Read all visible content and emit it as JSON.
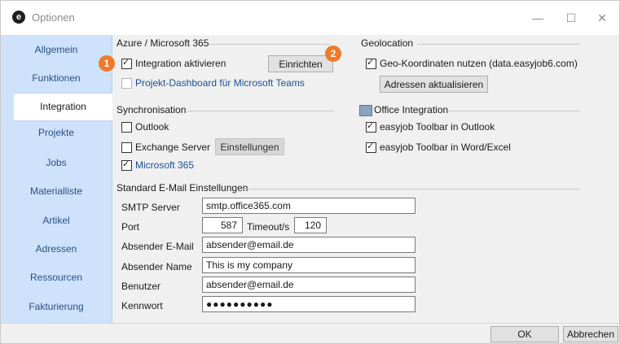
{
  "window": {
    "title": "Optionen",
    "icon": "e",
    "controls": {
      "minimize": "—",
      "maximize": "☐",
      "close": "✕"
    }
  },
  "sidebar": {
    "items": [
      {
        "label": "Allgemein",
        "active": false
      },
      {
        "label": "Funktionen",
        "active": false
      },
      {
        "label": "Integration",
        "active": true
      },
      {
        "label": "Projekte",
        "active": false
      },
      {
        "label": "Jobs",
        "active": false
      },
      {
        "label": "Materialliste",
        "active": false
      },
      {
        "label": "Artikel",
        "active": false
      },
      {
        "label": "Adressen",
        "active": false
      },
      {
        "label": "Ressourcen",
        "active": false
      },
      {
        "label": "Fakturierung",
        "active": false
      }
    ]
  },
  "azure": {
    "title": "Azure / Microsoft 365",
    "integration_label": "Integration aktivieren",
    "integration_checked": true,
    "setup_button": "Einrichten",
    "teams_label": "Projekt-Dashboard für Microsoft Teams",
    "teams_checked": false
  },
  "geo": {
    "title": "Geolocation",
    "coords_label": "Geo-Koordinaten  nutzen (data.easyjob6.com)",
    "coords_checked": true,
    "update_button": "Adressen aktualisieren"
  },
  "sync": {
    "title": "Synchronisation",
    "outlook_label": "Outlook",
    "outlook_checked": false,
    "exchange_label": "Exchange Server",
    "exchange_checked": false,
    "settings_button": "Einstellungen",
    "m365_label": "Microsoft 365",
    "m365_checked": true
  },
  "office": {
    "title": "Office Integration",
    "outlook_toolbar_label": "easyjob Toolbar in Outlook",
    "outlook_toolbar_checked": true,
    "word_toolbar_label": "easyjob Toolbar in Word/Excel",
    "word_toolbar_checked": true
  },
  "email": {
    "title": "Standard E-Mail Einstellungen",
    "smtp_label": "SMTP Server",
    "smtp_value": "smtp.office365.com",
    "port_label": "Port",
    "port_value": "587",
    "timeout_label": "Timeout/s",
    "timeout_value": "120",
    "sender_email_label": "Absender E-Mail",
    "sender_email_value": "absender@email.de",
    "sender_name_label": "Absender Name",
    "sender_name_value": "This is my company",
    "user_label": "Benutzer",
    "user_value": "absender@email.de",
    "password_label": "Kennwort",
    "password_value": "●●●●●●●●●●"
  },
  "badges": {
    "one": "1",
    "two": "2"
  },
  "footer": {
    "ok": "OK",
    "cancel": "Abbrechen"
  },
  "colors": {
    "sidebar": "#cfe2fb",
    "accent_badge": "#f07a2b",
    "link_blue": "#1c4f99"
  }
}
